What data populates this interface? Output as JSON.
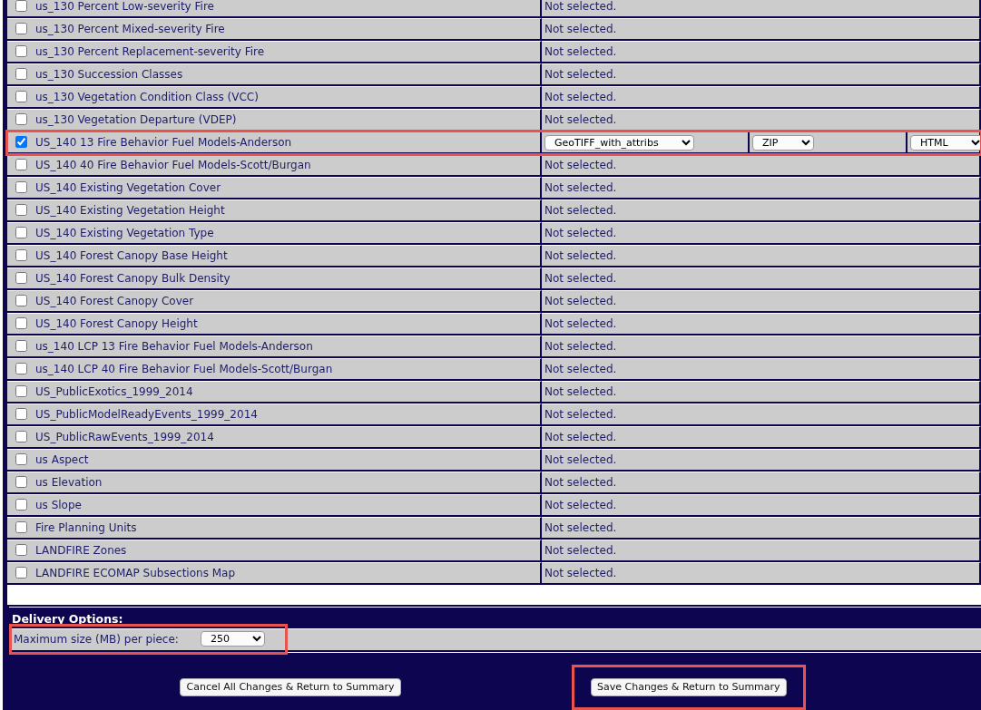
{
  "layers": [
    {
      "name": "us_130 Percent Low-severity Fire",
      "checked": false,
      "highlighted": false,
      "status": "Not selected."
    },
    {
      "name": "us_130 Percent Mixed-severity Fire",
      "checked": false,
      "highlighted": false,
      "status": "Not selected."
    },
    {
      "name": "us_130 Percent Replacement-severity Fire",
      "checked": false,
      "highlighted": false,
      "status": "Not selected."
    },
    {
      "name": "us_130 Succession Classes",
      "checked": false,
      "highlighted": false,
      "status": "Not selected."
    },
    {
      "name": "us_130 Vegetation Condition Class (VCC)",
      "checked": false,
      "highlighted": false,
      "status": "Not selected."
    },
    {
      "name": "us_130 Vegetation Departure (VDEP)",
      "checked": false,
      "highlighted": false,
      "status": "Not selected."
    },
    {
      "name": "US_140 13 Fire Behavior Fuel Models-Anderson",
      "checked": true,
      "highlighted": true,
      "options": [
        "GeoTIFF_with_attribs",
        "ZIP",
        "HTML"
      ]
    },
    {
      "name": "US_140 40 Fire Behavior Fuel Models-Scott/Burgan",
      "checked": false,
      "highlighted": false,
      "status": "Not selected."
    },
    {
      "name": "US_140 Existing Vegetation Cover",
      "checked": false,
      "highlighted": false,
      "status": "Not selected."
    },
    {
      "name": "US_140 Existing Vegetation Height",
      "checked": false,
      "highlighted": false,
      "status": "Not selected."
    },
    {
      "name": "US_140 Existing Vegetation Type",
      "checked": false,
      "highlighted": false,
      "status": "Not selected."
    },
    {
      "name": "US_140 Forest Canopy Base Height",
      "checked": false,
      "highlighted": false,
      "status": "Not selected."
    },
    {
      "name": "US_140 Forest Canopy Bulk Density",
      "checked": false,
      "highlighted": false,
      "status": "Not selected."
    },
    {
      "name": "US_140 Forest Canopy Cover",
      "checked": false,
      "highlighted": false,
      "status": "Not selected."
    },
    {
      "name": "US_140 Forest Canopy Height",
      "checked": false,
      "highlighted": false,
      "status": "Not selected."
    },
    {
      "name": "us_140 LCP 13 Fire Behavior Fuel Models-Anderson",
      "checked": false,
      "highlighted": false,
      "status": "Not selected."
    },
    {
      "name": "us_140 LCP 40 Fire Behavior Fuel Models-Scott/Burgan",
      "checked": false,
      "highlighted": false,
      "status": "Not selected."
    },
    {
      "name": "US_PublicExotics_1999_2014",
      "checked": false,
      "highlighted": false,
      "status": "Not selected."
    },
    {
      "name": "US_PublicModelReadyEvents_1999_2014",
      "checked": false,
      "highlighted": false,
      "status": "Not selected."
    },
    {
      "name": "US_PublicRawEvents_1999_2014",
      "checked": false,
      "highlighted": false,
      "status": "Not selected."
    },
    {
      "name": "us Aspect",
      "checked": false,
      "highlighted": false,
      "status": "Not selected."
    },
    {
      "name": "us Elevation",
      "checked": false,
      "highlighted": false,
      "status": "Not selected."
    },
    {
      "name": "us Slope",
      "checked": false,
      "highlighted": false,
      "status": "Not selected."
    },
    {
      "name": "Fire Planning Units",
      "checked": false,
      "highlighted": false,
      "status": "Not selected."
    },
    {
      "name": "LANDFIRE Zones",
      "checked": false,
      "highlighted": false,
      "status": "Not selected."
    },
    {
      "name": "LANDFIRE ECOMAP Subsections Map",
      "checked": false,
      "highlighted": false,
      "status": "Not selected."
    }
  ],
  "delivery": {
    "title": "Delivery Options:",
    "label": "Maximum size (MB) per piece:",
    "value": "250",
    "highlighted": true
  },
  "buttons": [
    {
      "label": "Cancel All Changes & Return to Summary",
      "highlighted": false
    },
    {
      "label": "Save Changes & Return to Summary",
      "highlighted": true
    }
  ]
}
